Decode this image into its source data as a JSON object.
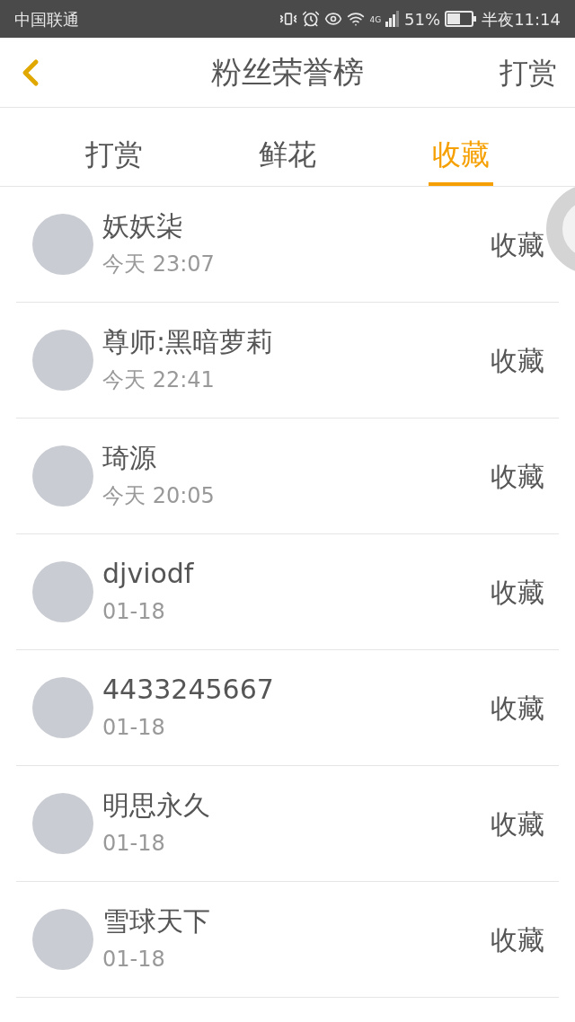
{
  "status_bar": {
    "carrier": "中国联通",
    "network": "4G",
    "battery": "51%",
    "time": "半夜11:14"
  },
  "header": {
    "title": "粉丝荣誉榜",
    "action": "打赏"
  },
  "tabs": [
    {
      "label": "打赏",
      "selected": false
    },
    {
      "label": "鲜花",
      "selected": false
    },
    {
      "label": "收藏",
      "selected": true
    }
  ],
  "rows": [
    {
      "name": "妖妖柒",
      "time": "今天 23:07",
      "action": "收藏"
    },
    {
      "name": "尊师:黑暗萝莉",
      "time": "今天 22:41",
      "action": "收藏"
    },
    {
      "name": "琦源",
      "time": "今天 20:05",
      "action": "收藏"
    },
    {
      "name": "djviodf",
      "time": "01-18",
      "action": "收藏"
    },
    {
      "name": "4433245667",
      "time": "01-18",
      "action": "收藏"
    },
    {
      "name": "明思永久",
      "time": "01-18",
      "action": "收藏"
    },
    {
      "name": "雪球天下",
      "time": "01-18",
      "action": "收藏"
    }
  ]
}
